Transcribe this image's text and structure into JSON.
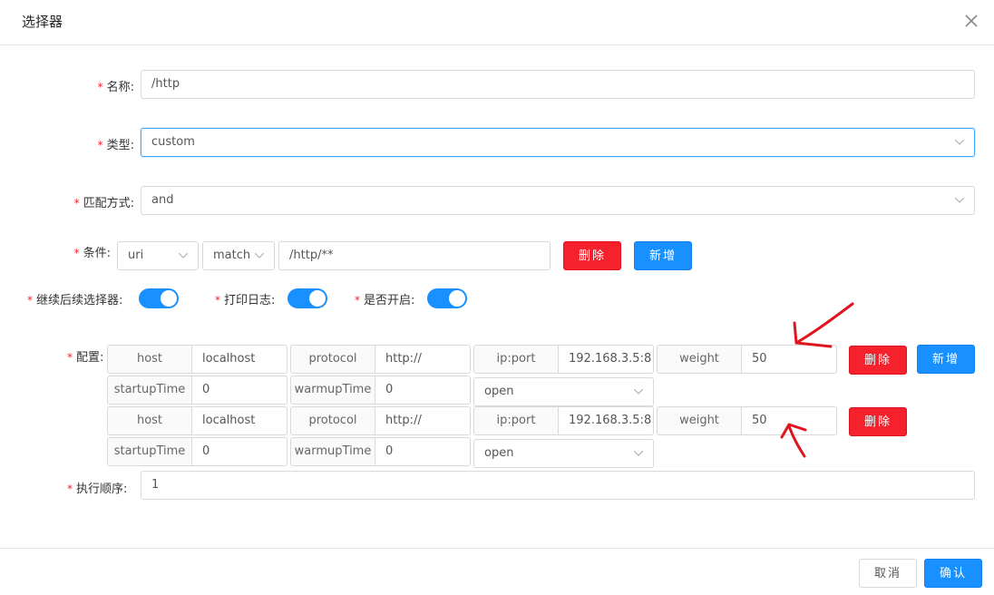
{
  "dialog": {
    "title": "选择器"
  },
  "form": {
    "name": {
      "label": "名称:",
      "value": "/http"
    },
    "type": {
      "label": "类型:",
      "value": "custom"
    },
    "match_mode": {
      "label": "匹配方式:",
      "value": "and"
    },
    "condition": {
      "label": "条件:",
      "param": "uri",
      "operator": "match",
      "value": "/http/**",
      "delete_label": "删除",
      "add_label": "新增"
    },
    "toggles": [
      {
        "label": "继续后续选择器:",
        "on": true
      },
      {
        "label": "打印日志:",
        "on": true
      },
      {
        "label": "是否开启:",
        "on": true
      }
    ],
    "config": {
      "label": "配置:",
      "rows": [
        {
          "host_label": "host",
          "host": "localhost",
          "protocol_label": "protocol",
          "protocol": "http://",
          "ipport_label": "ip:port",
          "ipport": "192.168.3.5:8",
          "weight_label": "weight",
          "weight": "50",
          "startup_label": "startupTime",
          "startup": "0",
          "warmup_label": "warmupTime",
          "warmup": "0",
          "status": "open",
          "delete_label": "删除",
          "add_label": "新增"
        },
        {
          "host_label": "host",
          "host": "localhost",
          "protocol_label": "protocol",
          "protocol": "http://",
          "ipport_label": "ip:port",
          "ipport": "192.168.3.5:8",
          "weight_label": "weight",
          "weight": "50",
          "startup_label": "startupTime",
          "startup": "0",
          "warmup_label": "warmupTime",
          "warmup": "0",
          "status": "open",
          "delete_label": "删除"
        }
      ]
    },
    "sort": {
      "label": "执行顺序:",
      "value": "1"
    }
  },
  "footer": {
    "cancel_label": "取消",
    "confirm_label": "确认"
  },
  "colors": {
    "primary": "#1890ff",
    "danger": "#f5222d",
    "annotation": "#e0141e"
  }
}
